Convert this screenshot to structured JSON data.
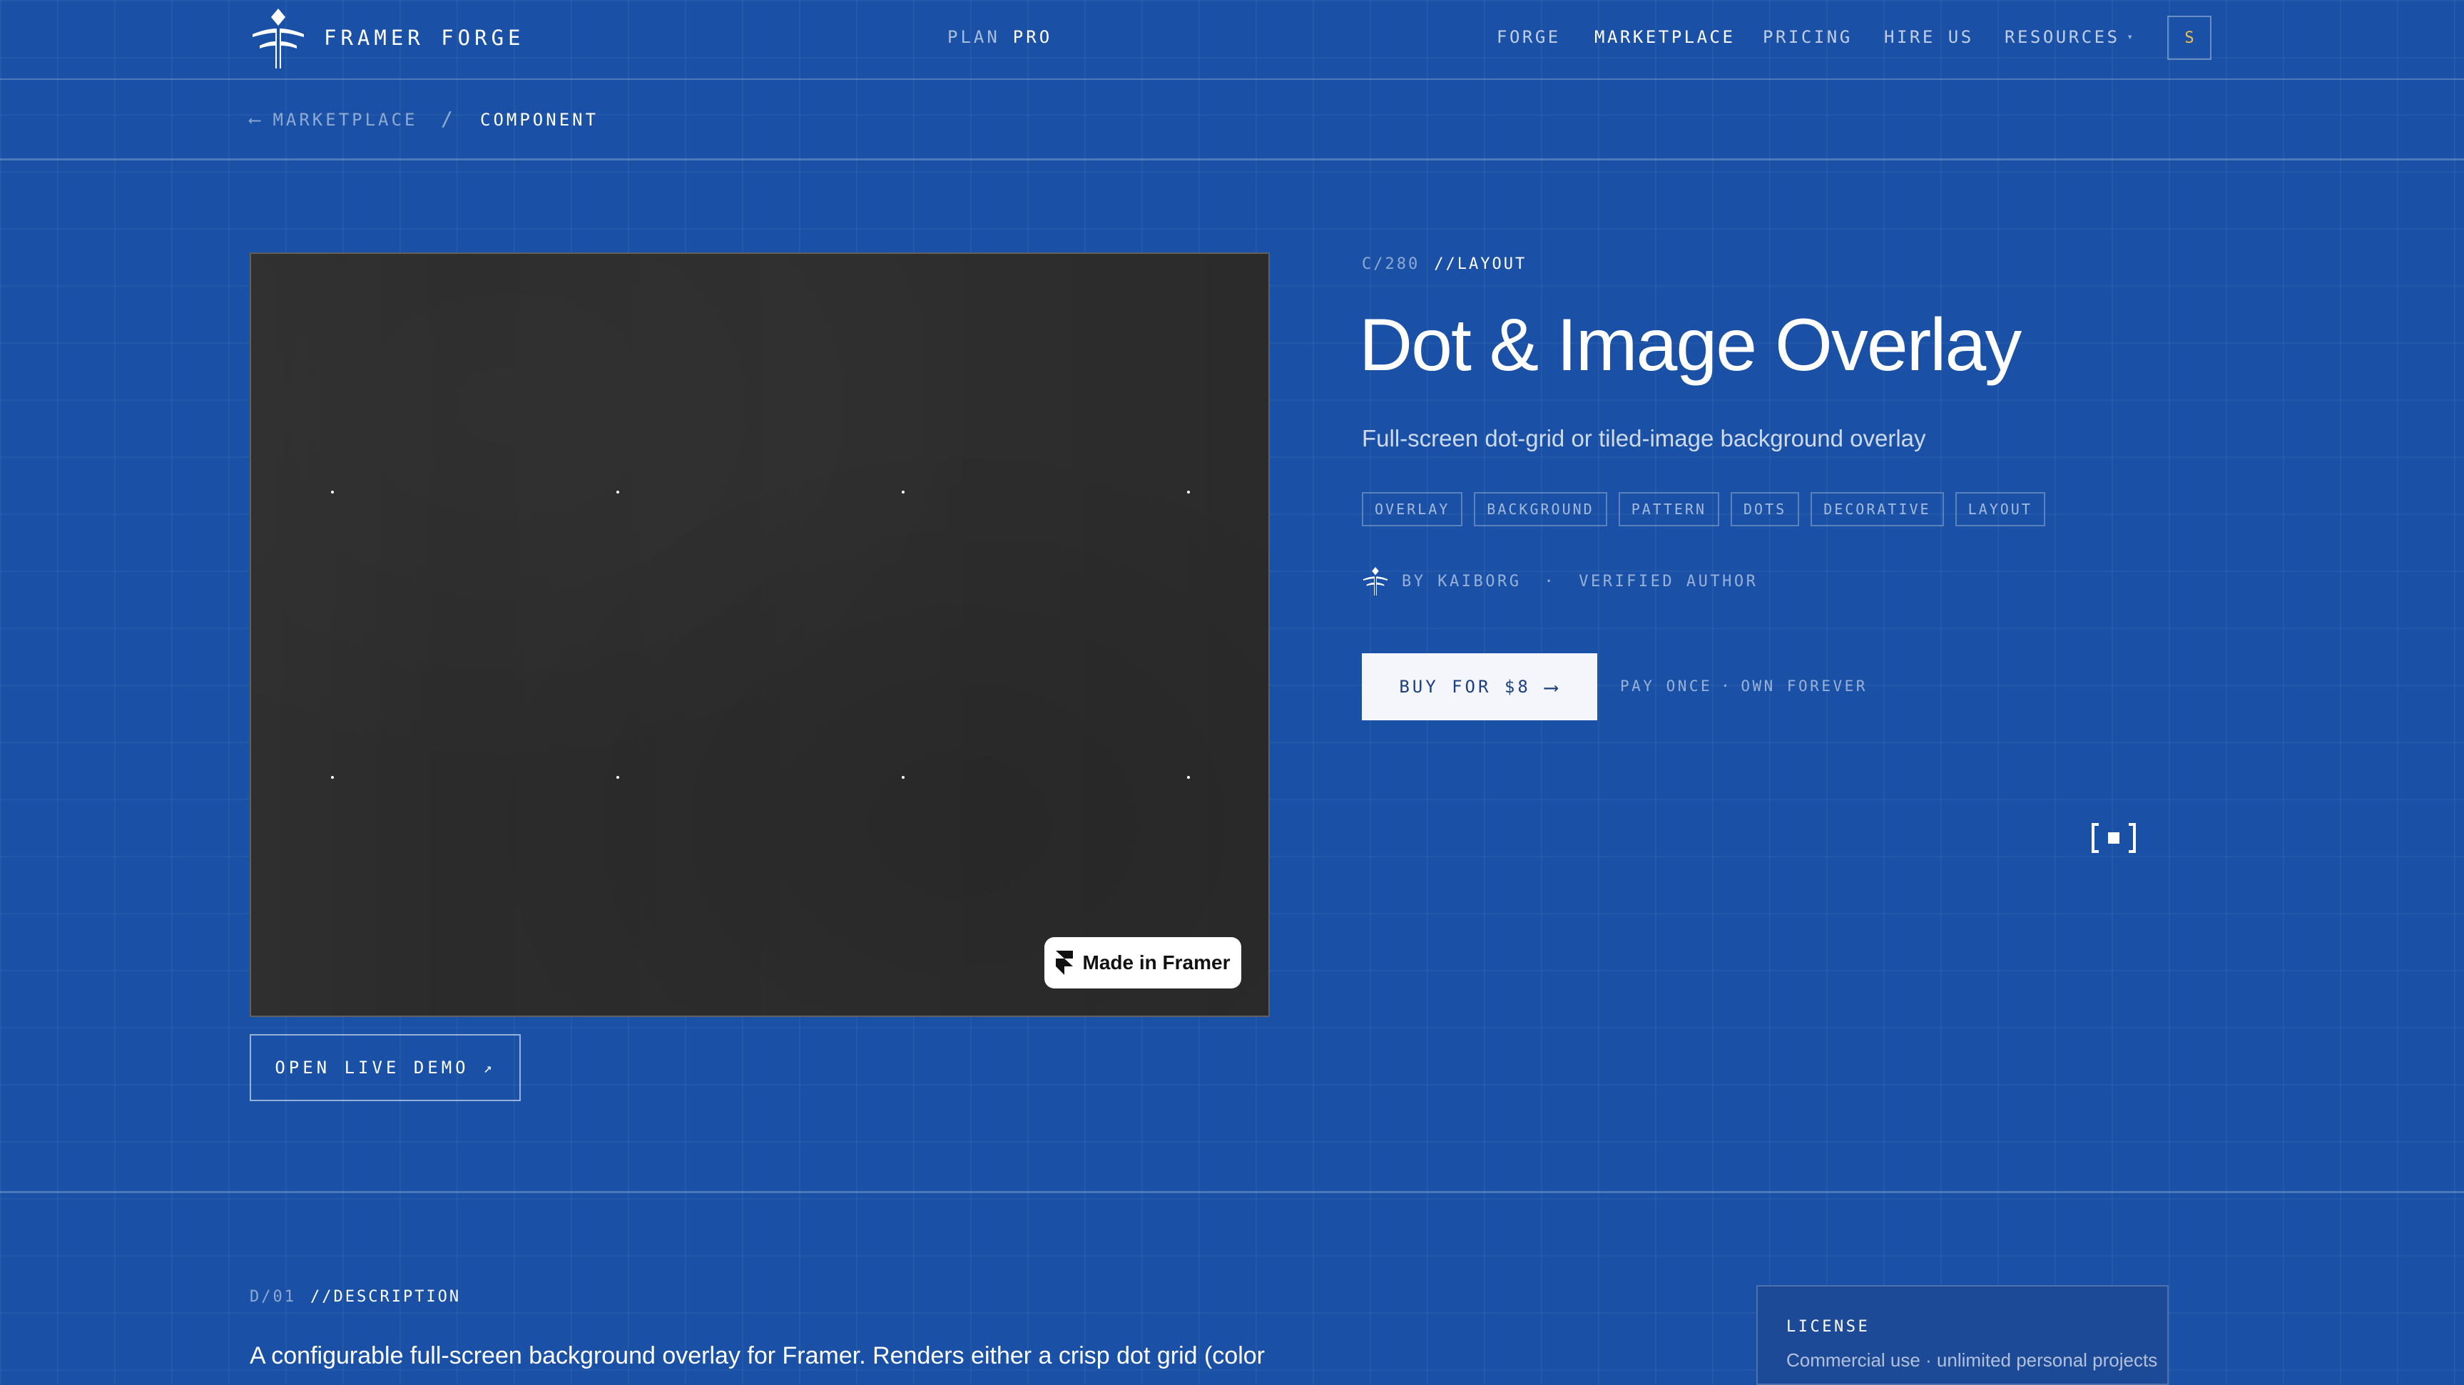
{
  "nav": {
    "brand": "FRAMER FORGE",
    "plan_label": "PLAN",
    "plan_value": "PRO",
    "links": [
      "FORGE",
      "MARKETPLACE",
      "PRICING",
      "HIRE US",
      "RESOURCES"
    ],
    "active_link": "MARKETPLACE",
    "avatar_initial": "S"
  },
  "breadcrumb": {
    "back_arrow": "⟵",
    "back_label": "MARKETPLACE",
    "separator": "/",
    "current": "COMPONENT"
  },
  "preview": {
    "badge": "Made in Framer",
    "demo_button": "OPEN LIVE DEMO",
    "demo_arrow": "↗"
  },
  "component": {
    "code": "C/280",
    "category": "//LAYOUT",
    "title": "Dot & Image Overlay",
    "subtitle": "Full-screen dot-grid or tiled-image background overlay",
    "tags": [
      "OVERLAY",
      "BACKGROUND",
      "PATTERN",
      "DOTS",
      "DECORATIVE",
      "LAYOUT"
    ],
    "author": "BY KAIBORG",
    "author_status": "VERIFIED AUTHOR",
    "buy_label": "BUY FOR $8",
    "buy_arrow": "⟶",
    "pay_note_1": "PAY ONCE",
    "pay_note_2": "OWN FOREVER"
  },
  "description": {
    "code": "D/01",
    "heading": "//DESCRIPTION",
    "text": "A configurable full-screen background overlay for Framer. Renders either a crisp dot grid (color"
  },
  "license": {
    "label": "LICENSE",
    "text": "Commercial use · unlimited personal projects"
  },
  "colors": {
    "background": "#1a51a6",
    "preview_background": "#2b2b2b",
    "buy_button": "#f4f6fb",
    "avatar_accent": "#f2c14e"
  }
}
